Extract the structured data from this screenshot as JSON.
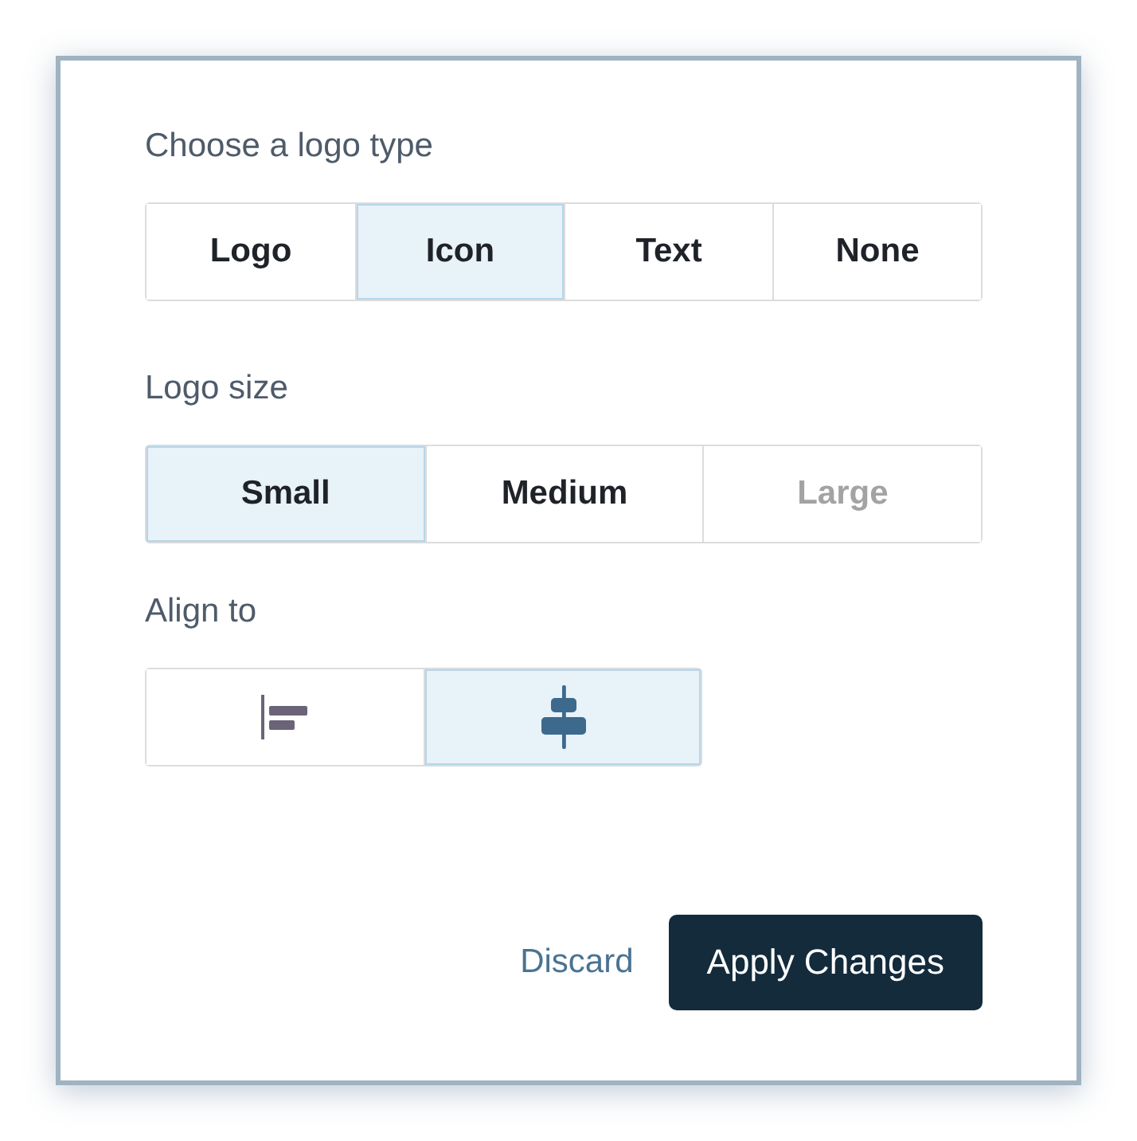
{
  "logo_type": {
    "label": "Choose a logo type",
    "options": [
      {
        "label": "Logo",
        "selected": false
      },
      {
        "label": "Icon",
        "selected": true
      },
      {
        "label": "Text",
        "selected": false
      },
      {
        "label": "None",
        "selected": false
      }
    ]
  },
  "logo_size": {
    "label": "Logo size",
    "options": [
      {
        "label": "Small",
        "selected": true,
        "disabled": false
      },
      {
        "label": "Medium",
        "selected": false,
        "disabled": false
      },
      {
        "label": "Large",
        "selected": false,
        "disabled": true
      }
    ]
  },
  "align": {
    "label": "Align to",
    "options": [
      {
        "kind": "left",
        "selected": false
      },
      {
        "kind": "center",
        "selected": true
      }
    ]
  },
  "footer": {
    "discard": "Discard",
    "apply": "Apply Changes"
  }
}
